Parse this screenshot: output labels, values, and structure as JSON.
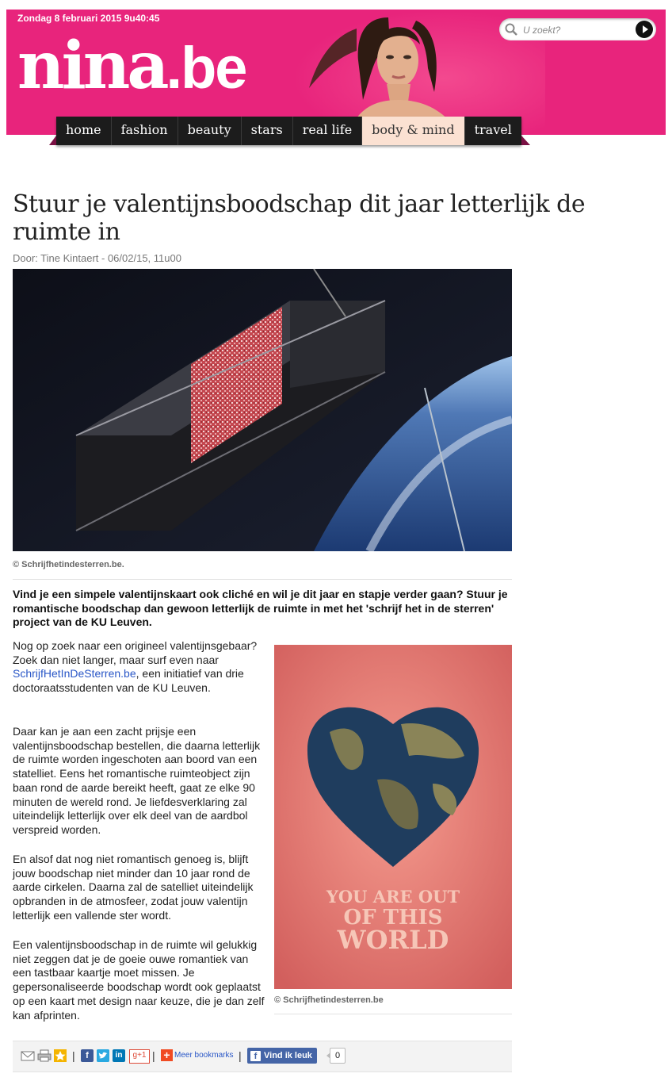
{
  "header": {
    "date": "Zondag 8 februari 2015  9u40:45",
    "logo_main": "nina",
    "logo_suffix": ".be",
    "search_placeholder": "U zoekt?"
  },
  "nav": {
    "items": [
      {
        "label": "home"
      },
      {
        "label": "fashion"
      },
      {
        "label": "beauty"
      },
      {
        "label": "stars"
      },
      {
        "label": "real life"
      },
      {
        "label": "body & mind",
        "active": true
      },
      {
        "label": "travel"
      }
    ]
  },
  "article": {
    "title": "Stuur je valentijnsboodschap dit jaar letterlijk de ruimte in",
    "byline": "Door: Tine Kintaert - 06/02/15, 11u00",
    "hero_caption": "© Schrijfhetindesterren.be.",
    "intro": "Vind je een simpele valentijnskaart ook cliché en wil je dit jaar en stapje verder gaan? Stuur je romantische boodschap dan gewoon letterlijk de ruimte in met het 'schrijf het in de sterren' project van de KU Leuven.",
    "p1_before": "Nog op zoek naar een origineel valentijnsgebaar? Zoek dan niet langer, maar surf even naar ",
    "p1_link": "SchrijfHetInDeSterren.be",
    "p1_after": ", een initiatief van drie doctoraatsstudenten van de KU Leuven.",
    "p2": "Daar kan je aan een zacht prijsje een valentijnsboodschap bestellen, die daarna letterlijk de ruimte worden ingeschoten aan boord van een statelliet. Eens het romantische ruimteobject zijn baan rond de aarde bereikt heeft, gaat ze elke 90 minuten de wereld rond. Je liefdesverklaring zal uiteindelijk letterlijk over elk deel van de aardbol verspreid worden.",
    "p3": "En alsof dat nog niet romantisch genoeg is, blijft jouw boodschap niet minder dan 10 jaar rond de aarde cirkelen. Daarna zal de satelliet uiteindelijk opbranden in de atmosfeer, zodat jouw valentijn letterlijk een vallende ster wordt.",
    "p4": "Een valentijnsboodschap in de ruimte wil gelukkig niet zeggen dat je de goeie ouwe romantiek van een tastbaar kaartje moet missen. Je gepersonaliseerde boodschap wordt ook geplaatst op een kaart met design naar keuze, die je dan zelf kan afprinten.",
    "card_line1": "YOU ARE OUT",
    "card_line2": "OF THIS",
    "card_line3": "WORLD",
    "card_caption": "© Schrijfhetindesterren.be"
  },
  "share": {
    "gplus": "g+1",
    "meer": "Meer bookmarks",
    "like": "Vind ik leuk",
    "like_count": "0",
    "sep": "|"
  }
}
